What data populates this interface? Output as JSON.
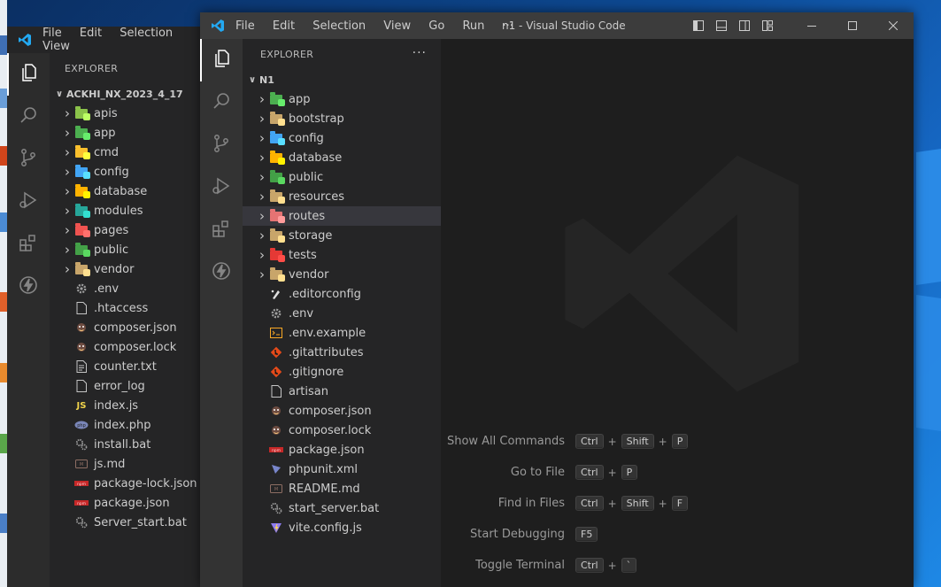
{
  "back_window": {
    "menu": [
      "File",
      "Edit",
      "Selection",
      "View"
    ],
    "explorer_title": "EXPLORER",
    "root": "ACKHI_NX_2023_4_17",
    "items": [
      {
        "name": "apis",
        "type": "folder",
        "color": "#8bc34a"
      },
      {
        "name": "app",
        "type": "folder",
        "color": "#4caf50"
      },
      {
        "name": "cmd",
        "type": "folder",
        "color": "#fbc02d"
      },
      {
        "name": "config",
        "type": "folder",
        "color": "#42a5f5"
      },
      {
        "name": "database",
        "type": "folder",
        "color": "#ffb300"
      },
      {
        "name": "modules",
        "type": "folder",
        "color": "#26a69a"
      },
      {
        "name": "pages",
        "type": "folder",
        "color": "#ef5350"
      },
      {
        "name": "public",
        "type": "folder",
        "color": "#43a047"
      },
      {
        "name": "vendor",
        "type": "folder",
        "color": "#c8a56a"
      },
      {
        "name": ".env",
        "type": "gear"
      },
      {
        "name": ".htaccess",
        "type": "file"
      },
      {
        "name": "composer.json",
        "type": "composer"
      },
      {
        "name": "composer.lock",
        "type": "composer"
      },
      {
        "name": "counter.txt",
        "type": "text"
      },
      {
        "name": "error_log",
        "type": "file"
      },
      {
        "name": "index.js",
        "type": "js"
      },
      {
        "name": "index.php",
        "type": "php"
      },
      {
        "name": "install.bat",
        "type": "bat"
      },
      {
        "name": "js.md",
        "type": "md"
      },
      {
        "name": "package-lock.json",
        "type": "npm"
      },
      {
        "name": "package.json",
        "type": "npm"
      },
      {
        "name": "Server_start.bat",
        "type": "bat"
      }
    ]
  },
  "front_window": {
    "menu": [
      "File",
      "Edit",
      "Selection",
      "View",
      "Go",
      "Run",
      "···"
    ],
    "title": "n1 - Visual Studio Code",
    "explorer_title": "EXPLORER",
    "explorer_more": "···",
    "root": "N1",
    "items": [
      {
        "name": "app",
        "type": "folder",
        "color": "#4caf50"
      },
      {
        "name": "bootstrap",
        "type": "folder",
        "color": "#c8a56a"
      },
      {
        "name": "config",
        "type": "folder",
        "color": "#42a5f5"
      },
      {
        "name": "database",
        "type": "folder",
        "color": "#ffb300"
      },
      {
        "name": "public",
        "type": "folder",
        "color": "#43a047"
      },
      {
        "name": "resources",
        "type": "folder",
        "color": "#c8a56a"
      },
      {
        "name": "routes",
        "type": "folder",
        "color": "#e57373",
        "selected": true
      },
      {
        "name": "storage",
        "type": "folder",
        "color": "#c8a56a"
      },
      {
        "name": "tests",
        "type": "folder",
        "color": "#e53935"
      },
      {
        "name": "vendor",
        "type": "folder",
        "color": "#c8a56a"
      },
      {
        "name": ".editorconfig",
        "type": "editorconfig"
      },
      {
        "name": ".env",
        "type": "gear"
      },
      {
        "name": ".env.example",
        "type": "terminal"
      },
      {
        "name": ".gitattributes",
        "type": "git"
      },
      {
        "name": ".gitignore",
        "type": "git"
      },
      {
        "name": "artisan",
        "type": "file"
      },
      {
        "name": "composer.json",
        "type": "composer"
      },
      {
        "name": "composer.lock",
        "type": "composer"
      },
      {
        "name": "package.json",
        "type": "npm"
      },
      {
        "name": "phpunit.xml",
        "type": "phpunit"
      },
      {
        "name": "README.md",
        "type": "md"
      },
      {
        "name": "start_server.bat",
        "type": "bat"
      },
      {
        "name": "vite.config.js",
        "type": "vite"
      }
    ],
    "hints": [
      {
        "label": "Show All Commands",
        "keys": [
          "Ctrl",
          "Shift",
          "P"
        ]
      },
      {
        "label": "Go to File",
        "keys": [
          "Ctrl",
          "P"
        ]
      },
      {
        "label": "Find in Files",
        "keys": [
          "Ctrl",
          "Shift",
          "F"
        ]
      },
      {
        "label": "Start Debugging",
        "keys": [
          "F5"
        ]
      },
      {
        "label": "Toggle Terminal",
        "keys": [
          "Ctrl",
          "`"
        ]
      }
    ]
  },
  "colors": {
    "accent": "#0078d4",
    "selection": "#37373d",
    "desktop": "#0d4a94"
  }
}
